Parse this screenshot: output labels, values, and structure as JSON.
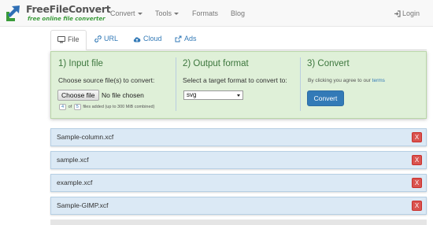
{
  "brand": {
    "name": "FreeFileConvert",
    "tagline": "free online file converter",
    "colors": {
      "blue": "#2f6fb5",
      "green": "#3a9b3a"
    }
  },
  "nav": {
    "items": [
      {
        "label": "Convert",
        "has_caret": true
      },
      {
        "label": "Tools",
        "has_caret": true
      },
      {
        "label": "Formats",
        "has_caret": false
      },
      {
        "label": "Blog",
        "has_caret": false
      }
    ],
    "login_label": "Login",
    "login_icon": "login-icon"
  },
  "tabs": [
    {
      "label": "File",
      "icon": "monitor-icon",
      "active": true
    },
    {
      "label": "URL",
      "icon": "link-icon",
      "active": false
    },
    {
      "label": "Cloud",
      "icon": "cloud-upload-icon",
      "active": false
    },
    {
      "label": "Ads",
      "icon": "external-link-icon",
      "active": false
    }
  ],
  "panel": {
    "step1": {
      "title": "1) Input file",
      "label": "Choose source file(s) to convert:",
      "choose_button": "Choose file",
      "no_file_text": "No file chosen",
      "files_count": "4",
      "files_of": "of",
      "files_max": "5",
      "files_suffix": "files added (up to 300 MiB combined)"
    },
    "step2": {
      "title": "2) Output format",
      "label": "Select a target format to convert to:",
      "selected_format": "svg"
    },
    "step3": {
      "title": "3) Convert",
      "agree_text": "By clicking you agree to our",
      "terms_link": "terms",
      "convert_button": "Convert"
    }
  },
  "files": [
    {
      "name": "Sample-column.xcf",
      "remove_label": "X"
    },
    {
      "name": "sample.xcf",
      "remove_label": "X"
    },
    {
      "name": "example.xcf",
      "remove_label": "X"
    },
    {
      "name": "Sample-GIMP.xcf",
      "remove_label": "X"
    }
  ]
}
